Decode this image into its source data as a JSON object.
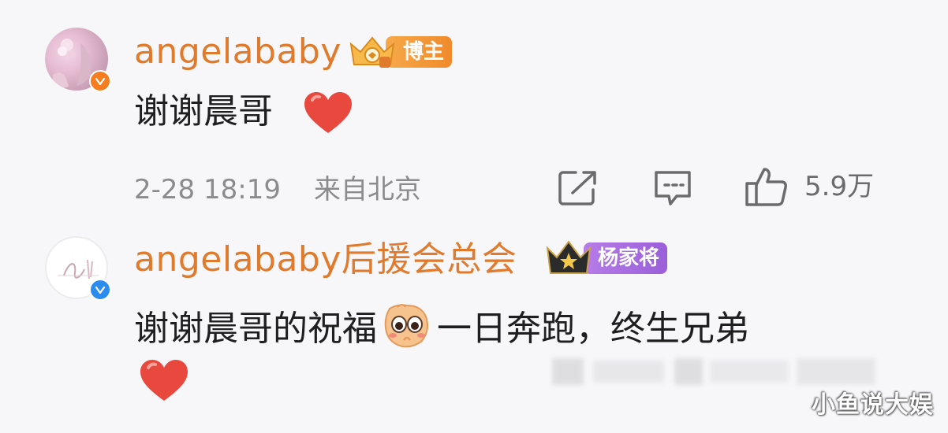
{
  "colors": {
    "username": "#e07b2e",
    "meta_text": "#8b8b8b",
    "comment_text": "#1f1f1f",
    "heart": "#e8483d",
    "badge_blogger": "#f29a3a",
    "badge_yang": "#a06be0",
    "verify_orange": "#f57c1f",
    "verify_blue": "#2b8cf0"
  },
  "comments": [
    {
      "username": "angelababy",
      "badge_label": "博主",
      "badge_icon": "crown-gold-icon",
      "verify_icon": "verified-orange-icon",
      "text": "谢谢晨哥",
      "emoji": "heart-icon",
      "time": "2-28 18:19",
      "location": "来自北京",
      "actions": {
        "share_icon": "share-icon",
        "reply_icon": "comment-icon",
        "like_icon": "thumbs-up-icon",
        "like_count": "5.9万"
      }
    },
    {
      "username": "angelababy后援会总会",
      "badge_label": "杨家将",
      "badge_icon": "crown-star-icon",
      "verify_icon": "verified-blue-icon",
      "text": "谢谢晨哥的祝福",
      "emoji": "shy-emoji-icon",
      "text_after": "一日奔跑，终生兄弟",
      "emoji_line2": "heart-icon"
    }
  ],
  "watermark": "小鱼说大娱"
}
